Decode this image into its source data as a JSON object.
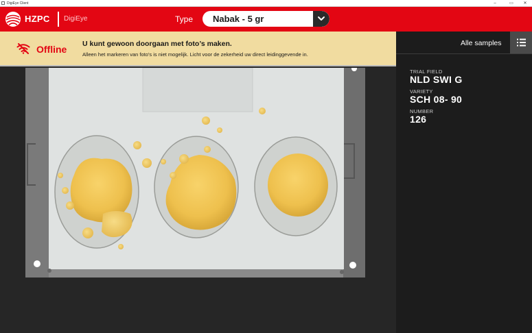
{
  "window": {
    "title": "DigiEye Client",
    "minimize_glyph": "–",
    "maximize_glyph": "▭",
    "close_glyph": "✕"
  },
  "header": {
    "brand": "HZPC",
    "app_name": "DigiEye",
    "type_label": "Type",
    "type_value": "Nabak - 5 gr"
  },
  "banner": {
    "status": "Offline",
    "title": "U kunt gewoon doorgaan met foto’s maken.",
    "subtitle": "Alleen het markeren van foto’s is niet mogelijk. Licht voor de zekerheid uw direct leidinggevende in."
  },
  "sidepanel": {
    "all_samples_label": "Alle samples",
    "fields": [
      {
        "label": "TRIAL FIELD",
        "value": "NLD SWI G"
      },
      {
        "label": "VARIETY",
        "value": "SCH 08- 90"
      },
      {
        "label": "NUMBER",
        "value": "126"
      }
    ]
  },
  "icons": {
    "logo": "hzpc-globe-icon",
    "status": "wifi-off-icon",
    "dropdown": "chevron-down-icon",
    "list": "list-icon"
  },
  "colors": {
    "brand_red": "#e30613",
    "banner_bg": "#f1dca0",
    "panel_bg": "#1c1c1c",
    "viewport_bg": "#262626"
  }
}
